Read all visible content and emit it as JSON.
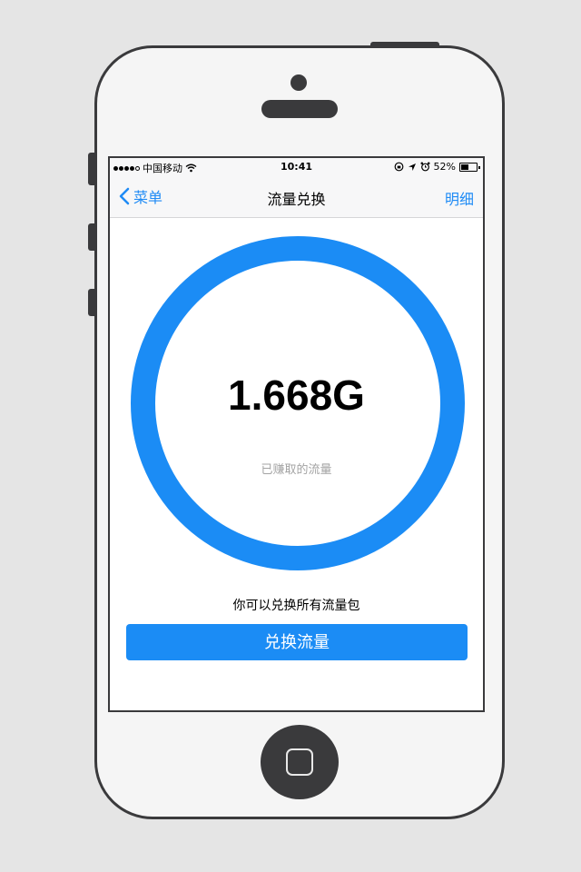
{
  "status_bar": {
    "carrier": "中国移动",
    "time": "10:41",
    "battery": "52%",
    "battery_level": 0.52
  },
  "nav": {
    "back_label": "菜单",
    "title": "流量兑换",
    "right_label": "明细"
  },
  "main": {
    "amount": "1.668G",
    "amount_caption": "已赚取的流量",
    "hint": "你可以兑换所有流量包",
    "button_label": "兑换流量"
  },
  "colors": {
    "accent": "#1b8cf5",
    "frame": "#3a3a3c",
    "background": "#e5e5e5"
  },
  "icons": [
    "signal-dots-icon",
    "wifi-icon",
    "lock-rotation-icon",
    "location-arrow-icon",
    "alarm-icon",
    "battery-icon",
    "chevron-left-icon",
    "home-button-icon"
  ]
}
